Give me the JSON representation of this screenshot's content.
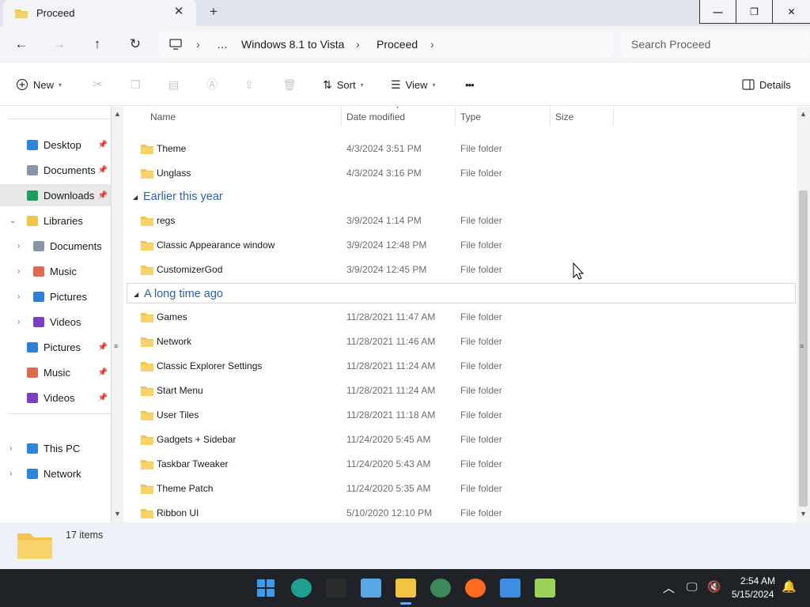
{
  "window": {
    "tab_title": "Proceed",
    "tab_close": "✕",
    "new_tab": "+",
    "controls": {
      "minimize": "—",
      "maximize": "❐",
      "close": "✕"
    }
  },
  "nav": {
    "back": "←",
    "forward": "→",
    "up": "↑",
    "refresh": "↻",
    "more": "…",
    "breadcrumb": [
      "Windows 8.1 to Vista",
      "Proceed"
    ],
    "search_placeholder": "Search Proceed"
  },
  "commands": {
    "new": "New",
    "sort": "Sort",
    "view": "View",
    "more": "•••",
    "details": "Details"
  },
  "sidebar": {
    "quick": [
      {
        "label": "Desktop",
        "icon": "desktop-icon",
        "color": "#2b88d8",
        "pinned": true
      },
      {
        "label": "Documents",
        "icon": "documents-icon",
        "color": "#8a96a8",
        "pinned": true
      },
      {
        "label": "Downloads",
        "icon": "downloads-icon",
        "color": "#1d9e5a",
        "pinned": true,
        "selected": true
      }
    ],
    "libraries": {
      "label": "Libraries",
      "items": [
        {
          "label": "Documents",
          "icon": "documents-icon",
          "color": "#8a96a8"
        },
        {
          "label": "Music",
          "icon": "music-icon",
          "color": "#e06a4f"
        },
        {
          "label": "Pictures",
          "icon": "pictures-icon",
          "color": "#2f7ed8"
        },
        {
          "label": "Videos",
          "icon": "videos-icon",
          "color": "#7a3fc2"
        }
      ]
    },
    "pinned_more": [
      {
        "label": "Pictures",
        "icon": "pictures-icon",
        "color": "#2f7ed8"
      },
      {
        "label": "Music",
        "icon": "music-icon",
        "color": "#e06a4f"
      },
      {
        "label": "Videos",
        "icon": "videos-icon",
        "color": "#7a3fc2"
      }
    ],
    "this_pc": "This PC",
    "network": "Network"
  },
  "columns": [
    "Name",
    "Date modified",
    "Type",
    "Size"
  ],
  "groups": [
    {
      "label": "",
      "rows": [
        {
          "name": "Theme",
          "date": "4/3/2024 3:51 PM",
          "type": "File folder"
        },
        {
          "name": "Unglass",
          "date": "4/3/2024 3:16 PM",
          "type": "File folder"
        }
      ]
    },
    {
      "label": "Earlier this year",
      "rows": [
        {
          "name": "regs",
          "date": "3/9/2024 1:14 PM",
          "type": "File folder"
        },
        {
          "name": "Classic Appearance window",
          "date": "3/9/2024 12:48 PM",
          "type": "File folder"
        },
        {
          "name": "CustomizerGod",
          "date": "3/9/2024 12:45 PM",
          "type": "File folder"
        }
      ]
    },
    {
      "label": "A long time ago",
      "rows": [
        {
          "name": "Games",
          "date": "11/28/2021 11:47 AM",
          "type": "File folder"
        },
        {
          "name": "Network",
          "date": "11/28/2021 11:46 AM",
          "type": "File folder"
        },
        {
          "name": "Classic Explorer Settings",
          "date": "11/28/2021 11:24 AM",
          "type": "File folder"
        },
        {
          "name": "Start Menu",
          "date": "11/28/2021 11:24 AM",
          "type": "File folder"
        },
        {
          "name": "User Tiles",
          "date": "11/28/2021 11:18 AM",
          "type": "File folder"
        },
        {
          "name": "Gadgets + Sidebar",
          "date": "11/24/2020 5:45 AM",
          "type": "File folder"
        },
        {
          "name": "Taskbar Tweaker",
          "date": "11/24/2020 5:43 AM",
          "type": "File folder"
        },
        {
          "name": "Theme Patch",
          "date": "11/24/2020 5:35 AM",
          "type": "File folder"
        },
        {
          "name": "Ribbon UI",
          "date": "5/10/2020 12:10 PM",
          "type": "File folder"
        }
      ]
    }
  ],
  "status": {
    "count": "17 items"
  },
  "taskbar": {
    "time": "2:54 AM",
    "date": "5/15/2024",
    "apps": [
      {
        "name": "start-button",
        "color": "#3a9cf0"
      },
      {
        "name": "edge-icon",
        "color": "#1f9f8f"
      },
      {
        "name": "terminal-icon",
        "color": "#2c2c2c"
      },
      {
        "name": "control-panel-icon",
        "color": "#5aa7e6"
      },
      {
        "name": "file-explorer-icon",
        "color": "#f2c443"
      },
      {
        "name": "chrome-icon",
        "color": "#3c8a5a"
      },
      {
        "name": "firefox-icon",
        "color": "#ff6a1f"
      },
      {
        "name": "notepad-icon",
        "color": "#3b8ee0"
      },
      {
        "name": "notepad-plus-icon",
        "color": "#9bd35a"
      }
    ]
  },
  "colors": {
    "accent": "#0067c0",
    "group": "#2a62b8",
    "folder": "#f3c44b"
  }
}
